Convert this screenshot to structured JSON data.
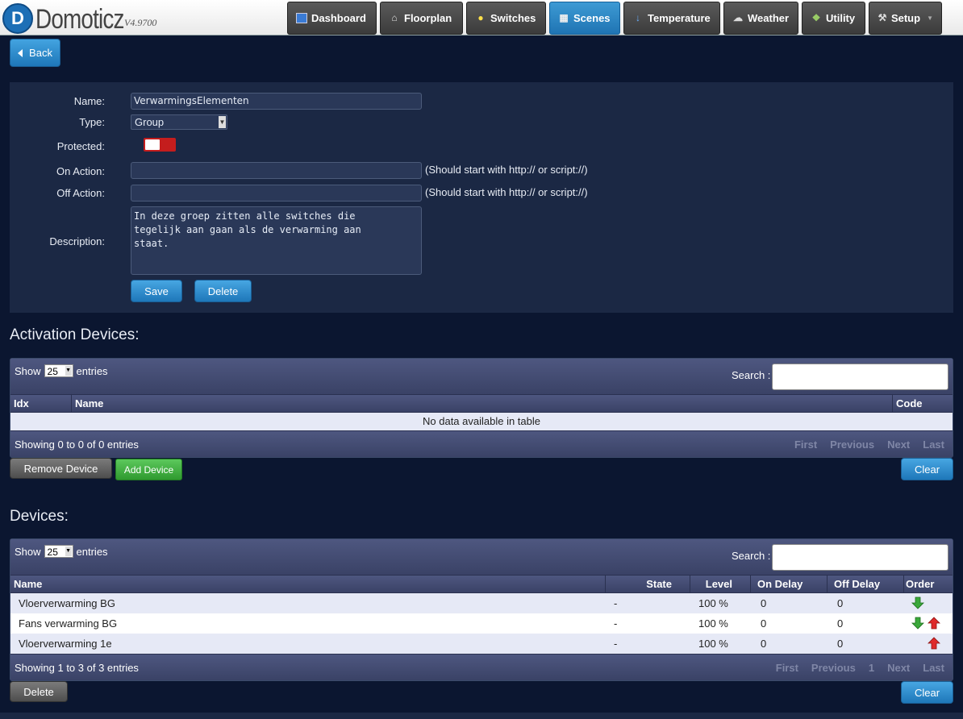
{
  "header": {
    "logo_letter": "D",
    "app_name": "Domoticz",
    "version": "V4.9700",
    "nav": [
      {
        "label": "Dashboard",
        "icon": "dashboard-icon"
      },
      {
        "label": "Floorplan",
        "icon": "house-icon"
      },
      {
        "label": "Switches",
        "icon": "lightbulb-icon"
      },
      {
        "label": "Scenes",
        "icon": "scenes-icon"
      },
      {
        "label": "Temperature",
        "icon": "thermometer-icon"
      },
      {
        "label": "Weather",
        "icon": "cloud-icon"
      },
      {
        "label": "Utility",
        "icon": "utility-icon"
      },
      {
        "label": "Setup",
        "icon": "tools-icon"
      }
    ],
    "active_nav": "Scenes"
  },
  "back_label": "Back",
  "form": {
    "name_label": "Name:",
    "name_value": "VerwarmingsElementen",
    "type_label": "Type:",
    "type_value": "Group",
    "protected_label": "Protected:",
    "on_action_label": "On Action:",
    "off_action_label": "Off Action:",
    "action_hint": "(Should start with http:// or script://)",
    "description_label": "Description:",
    "description_value": "In deze groep zitten alle switches die\ntegelijk aan gaan als de verwarming aan\nstaat.",
    "save_label": "Save",
    "delete_label": "Delete"
  },
  "activation": {
    "title": "Activation Devices:",
    "show_prefix": "Show",
    "show_value": "25",
    "show_suffix": "entries",
    "search_label": "Search :",
    "columns": [
      "Idx",
      "Name",
      "Code"
    ],
    "empty_text": "No data available in table",
    "info": "Showing 0 to 0 of 0 entries",
    "pager": [
      "First",
      "Previous",
      "Next",
      "Last"
    ],
    "remove_label": "Remove Device",
    "add_label": "Add Device",
    "clear_label": "Clear"
  },
  "devices": {
    "title": "Devices:",
    "show_prefix": "Show",
    "show_value": "25",
    "show_suffix": "entries",
    "search_label": "Search :",
    "columns": [
      "Name",
      "State",
      "Level",
      "On Delay",
      "Off Delay",
      "Order"
    ],
    "rows": [
      {
        "name": "Vloerverwarming BG",
        "state": "-",
        "level": "100 %",
        "on_delay": "0",
        "off_delay": "0",
        "order": [
          "down"
        ]
      },
      {
        "name": "Fans verwarming BG",
        "state": "-",
        "level": "100 %",
        "on_delay": "0",
        "off_delay": "0",
        "order": [
          "down",
          "up"
        ]
      },
      {
        "name": "Vloerverwarming 1e",
        "state": "-",
        "level": "100 %",
        "on_delay": "0",
        "off_delay": "0",
        "order": [
          "up"
        ]
      }
    ],
    "info": "Showing 1 to 3 of 3 entries",
    "pager": [
      "First",
      "Previous",
      "1",
      "Next",
      "Last"
    ],
    "delete_label": "Delete",
    "clear_label": "Clear"
  },
  "colors": {
    "background": "#0b1630",
    "panel": "#1b2844",
    "accent_blue": "#1e77b9",
    "toggle_off": "#c41d1d",
    "arrow_down": "#3aa83a",
    "arrow_up": "#e02a2a"
  }
}
